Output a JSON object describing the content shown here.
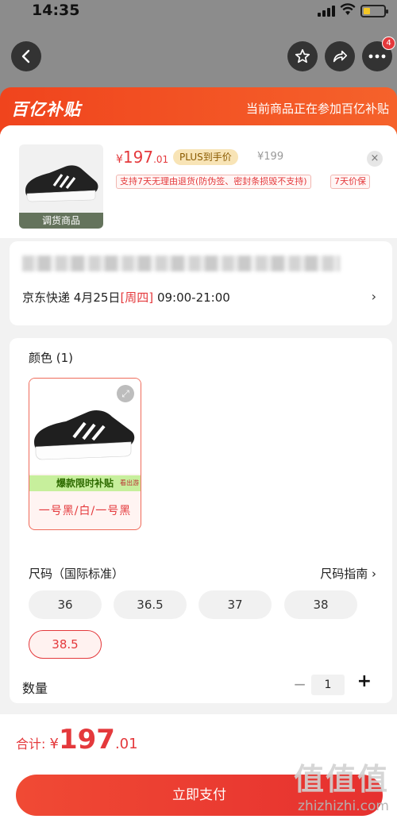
{
  "status_bar": {
    "time": "14:35"
  },
  "header": {
    "badge_count": "4"
  },
  "banner": {
    "logo": "百亿补贴",
    "note": "当前商品正在参加百亿补贴"
  },
  "product": {
    "tag": "调货商品",
    "price_symbol": "¥",
    "price_int": "197",
    "price_dec": ".01",
    "plus_label": "PLUS到手价",
    "original_price": "¥199",
    "close_icon": "×",
    "services": [
      "支持7天无理由退货(防伪签、密封条损毁不支持)",
      "7天价保"
    ]
  },
  "address": {
    "delivery": {
      "carrier": "京东快递",
      "date": "4月25日",
      "weekday": "[周四]",
      "time": "09:00-21:00"
    },
    "chevron": "›"
  },
  "color": {
    "heading": "颜色 (1)",
    "promo": "爆款限时补贴",
    "promo_sub": "看出游",
    "name": "一号黑/白/一号黑"
  },
  "size": {
    "heading": "尺码（国际标准）",
    "guide": "尺码指南 ›",
    "options": [
      "36",
      "36.5",
      "37",
      "38",
      "38.5"
    ],
    "selected": "38.5"
  },
  "quantity": {
    "label": "数量",
    "minus": "−",
    "value": "1",
    "plus": "+"
  },
  "footer": {
    "total_label": "合计:",
    "total_symbol": "¥",
    "total_int": "197",
    "total_dec": ".01",
    "pay_button": "立即支付"
  },
  "watermark": {
    "line1": "值值值",
    "line2": "zhizhizhi.com"
  },
  "colors": {
    "accent": "#e4393c",
    "banner": "#f0441d",
    "plus_bg": "#f8e4b6",
    "promo_green": "#c7ef9c"
  }
}
